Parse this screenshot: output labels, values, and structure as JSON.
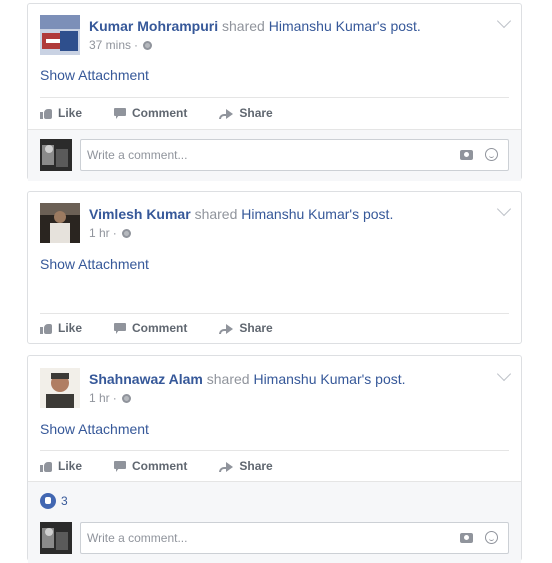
{
  "posts": [
    {
      "author": "Kumar Mohrampuri",
      "verb": "shared",
      "shared_from": "Himanshu Kumar",
      "suffix": "'s post.",
      "time": "37 mins",
      "sep": "·",
      "attachment_link": "Show Attachment",
      "avatar_colors": [
        "#c9d2e3",
        "#b03a3a",
        "#2e4f8d"
      ]
    },
    {
      "author": "Vimlesh Kumar",
      "verb": "shared",
      "shared_from": "Himanshu Kumar",
      "suffix": "'s post.",
      "time": "1 hr",
      "sep": "·",
      "attachment_link": "Show Attachment",
      "avatar_colors": [
        "#2a2520",
        "#6b6055",
        "#e6e2dc"
      ]
    },
    {
      "author": "Shahnawaz Alam",
      "verb": "shared",
      "shared_from": "Himanshu Kumar",
      "suffix": "'s post.",
      "time": "1 hr",
      "sep": "·",
      "attachment_link": "Show Attachment",
      "avatar_colors": [
        "#3c3a36",
        "#b07e63",
        "#f2efe9"
      ]
    }
  ],
  "actions": {
    "like": "Like",
    "comment": "Comment",
    "share": "Share"
  },
  "comment_box": {
    "placeholder": "Write a comment..."
  },
  "reactions": {
    "count": "3"
  },
  "colors": {
    "link": "#365899",
    "muted": "#90949c",
    "border": "#dddfe2"
  }
}
